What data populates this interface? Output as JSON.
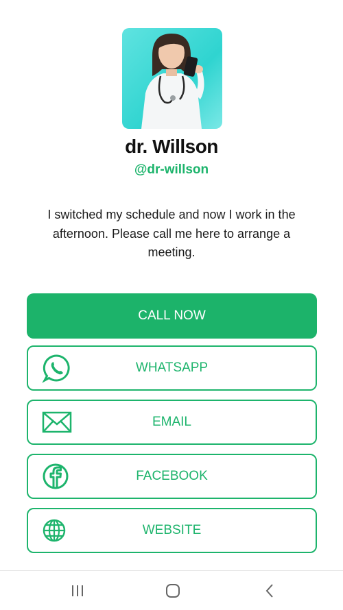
{
  "profile": {
    "name": "dr. Willson",
    "handle": "@dr-willson",
    "bio": "I switched my schedule and now I work in the afternoon. Please call me here to arrange a meeting."
  },
  "buttons": {
    "call": {
      "label": "CALL NOW"
    },
    "whatsapp": {
      "label": "WHATSAPP",
      "icon": "whatsapp-icon"
    },
    "email": {
      "label": "EMAIL",
      "icon": "email-icon"
    },
    "facebook": {
      "label": "FACEBOOK",
      "icon": "facebook-icon"
    },
    "website": {
      "label": "WEBSITE",
      "icon": "globe-icon"
    }
  },
  "navbar": {
    "recent": "recent-apps-icon",
    "home": "home-icon",
    "back": "back-icon"
  },
  "colors": {
    "accent": "#1cb36a",
    "text": "#111111",
    "background": "#ffffff"
  }
}
